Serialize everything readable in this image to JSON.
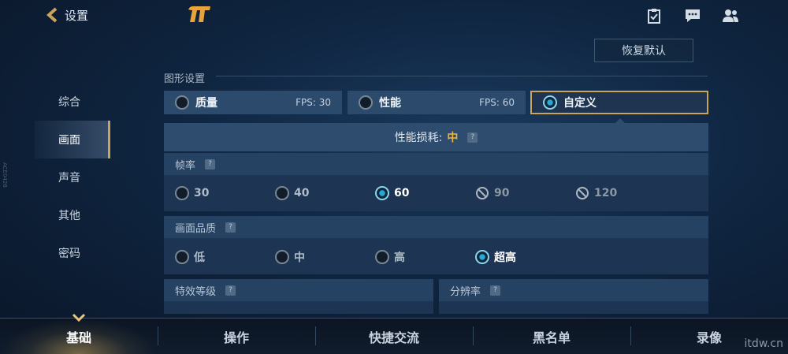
{
  "header": {
    "back_label": "设置"
  },
  "toolbar": {
    "reset_label": "恢复默认"
  },
  "side_tag": "ACE0426",
  "nav": {
    "items": [
      {
        "label": "综合"
      },
      {
        "label": "画面"
      },
      {
        "label": "声音"
      },
      {
        "label": "其他"
      },
      {
        "label": "密码"
      }
    ],
    "active_index": 1
  },
  "graphics": {
    "section_title": "图形设置",
    "presets": [
      {
        "name": "质量",
        "fps": "FPS: 30"
      },
      {
        "name": "性能",
        "fps": "FPS: 60"
      },
      {
        "name": "自定义",
        "fps": ""
      }
    ],
    "selected_preset": 2,
    "cost_label": "性能损耗:",
    "cost_value": "中",
    "help_glyph": "?",
    "framerate": {
      "title": "帧率",
      "options": [
        "30",
        "40",
        "60",
        "90",
        "120"
      ],
      "selected": 2,
      "disabled": [
        3,
        4
      ]
    },
    "quality": {
      "title": "画面品质",
      "options": [
        "低",
        "中",
        "高",
        "超高"
      ],
      "selected": 3
    },
    "effects": {
      "title": "特效等级"
    },
    "resolution": {
      "title": "分辨率"
    }
  },
  "bottom_tabs": [
    {
      "label": "基础"
    },
    {
      "label": "操作"
    },
    {
      "label": "快捷交流"
    },
    {
      "label": "黑名单"
    },
    {
      "label": "录像"
    }
  ],
  "watermark": "itdw.cn",
  "colors": {
    "accent_gold": "#c9a45a",
    "cost_orange": "#f0b43c",
    "radio_on": "#2aa7d6"
  }
}
